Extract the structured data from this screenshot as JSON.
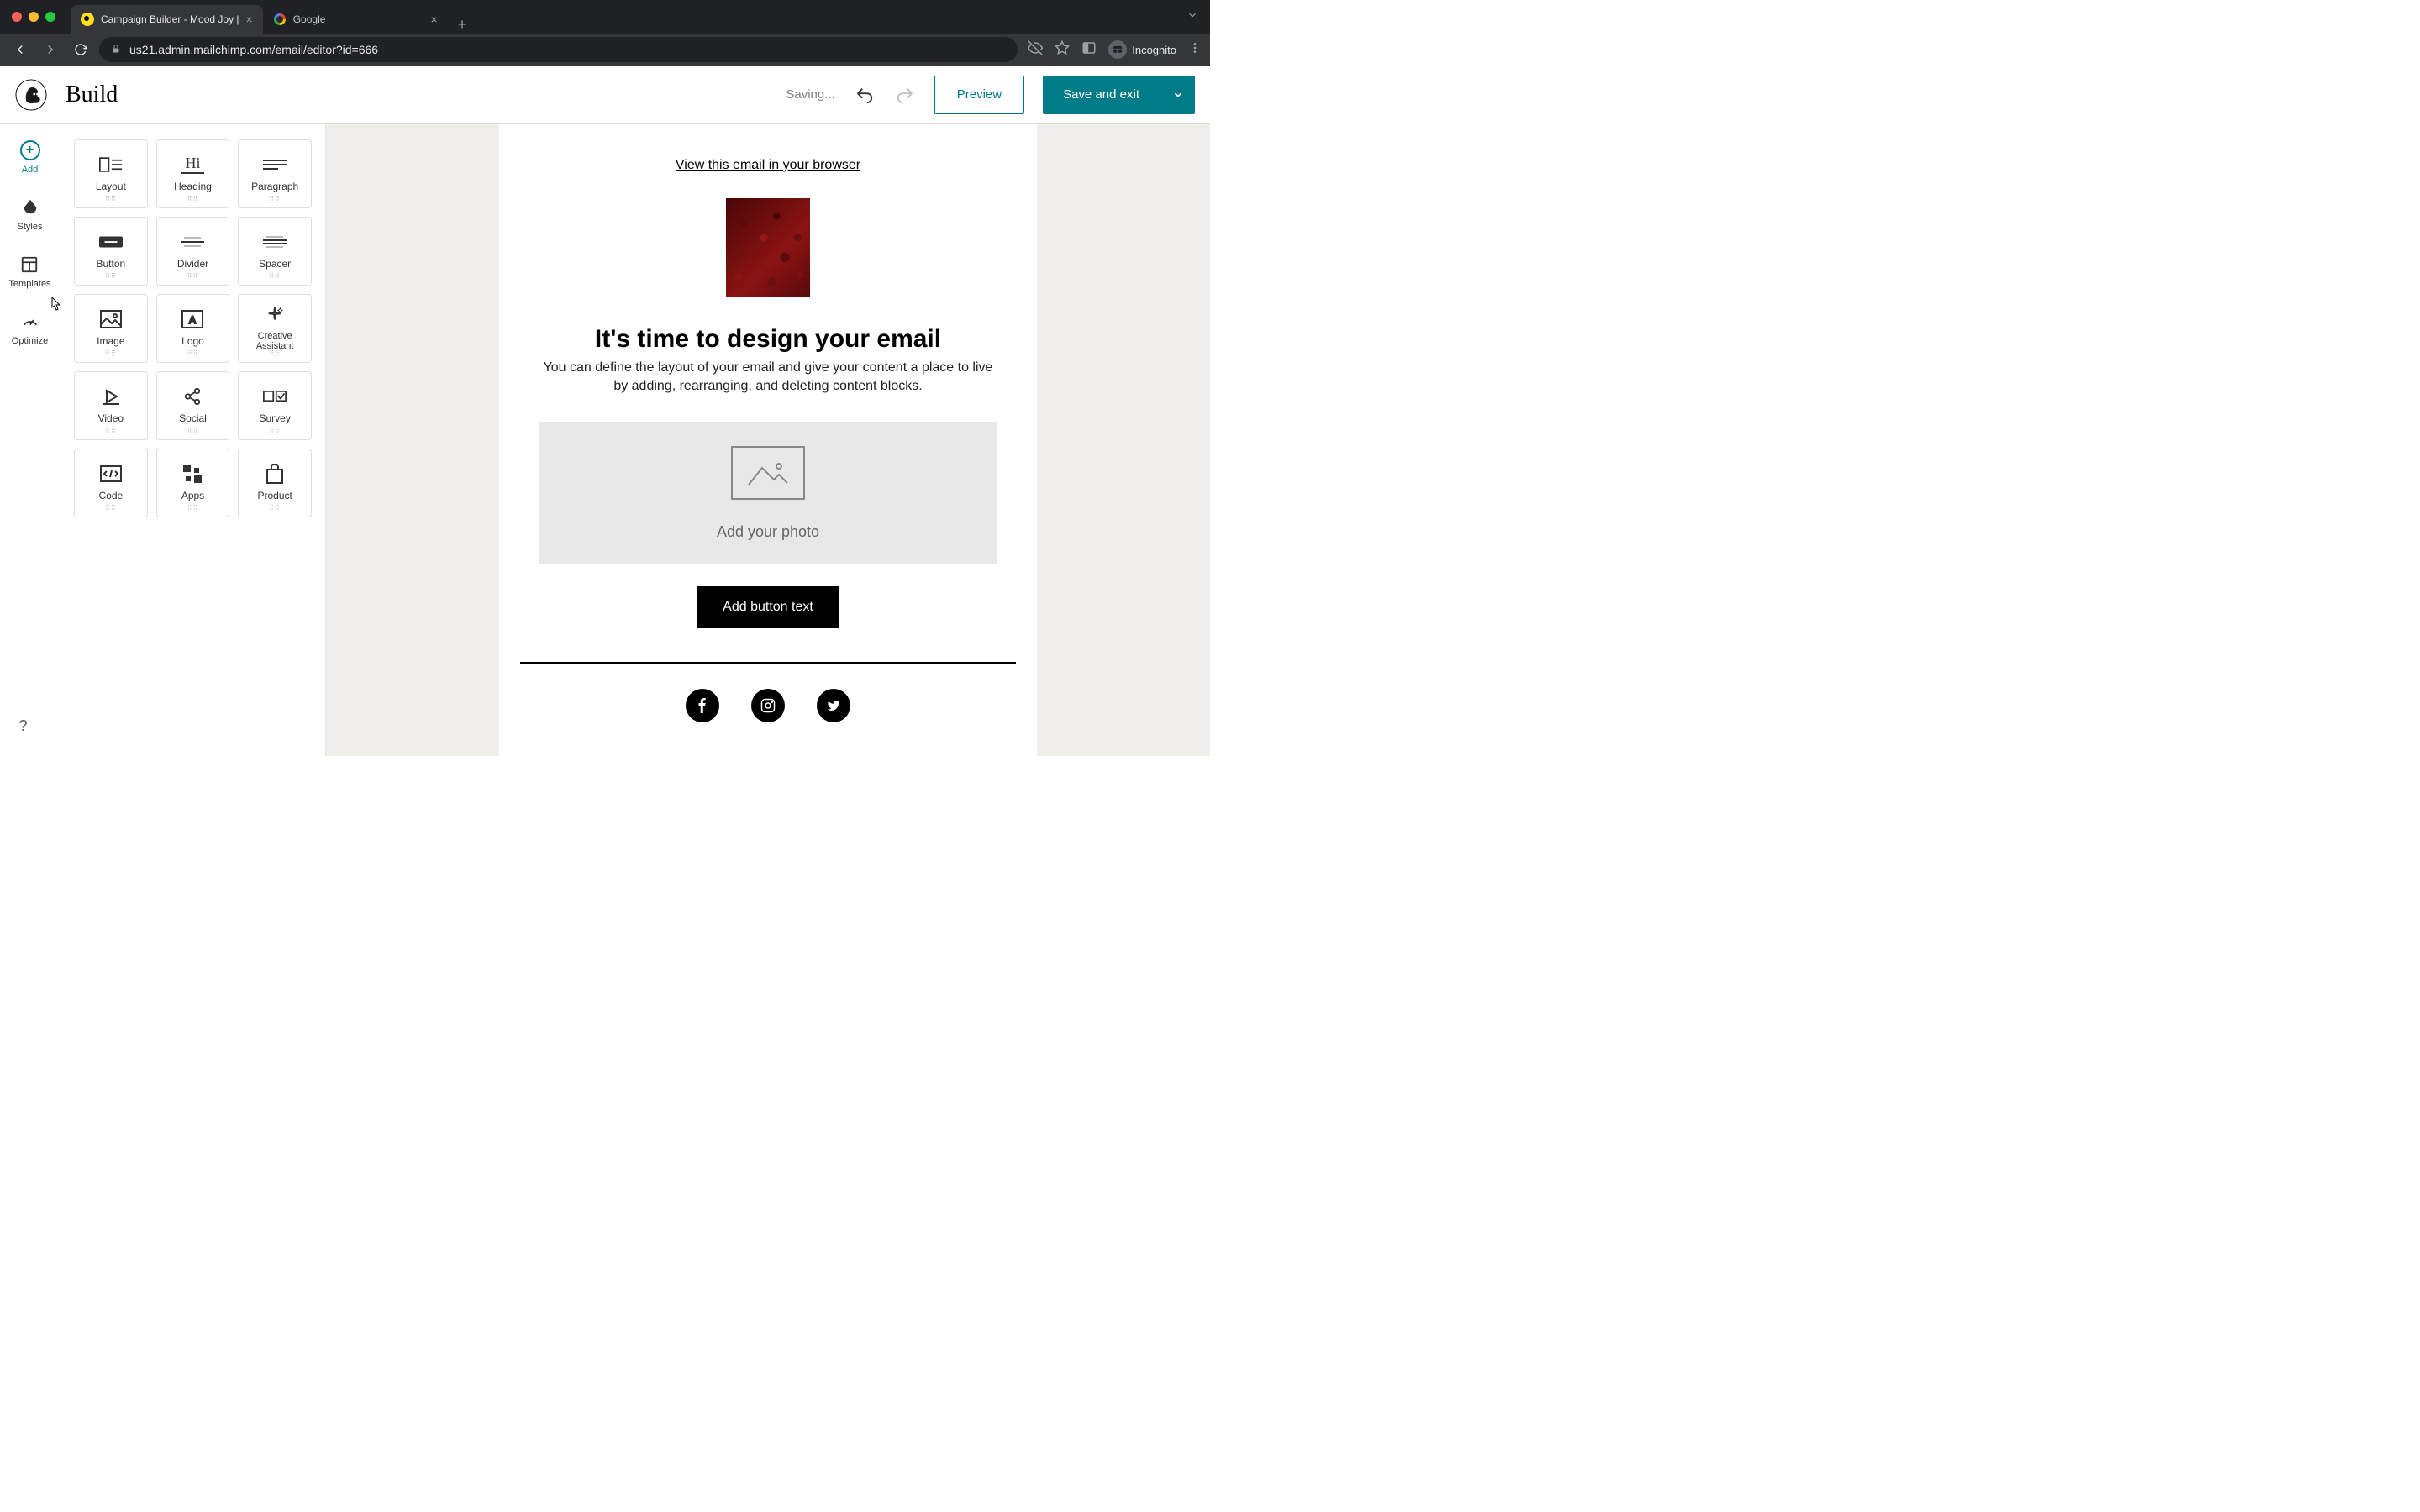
{
  "browser": {
    "tabs": [
      {
        "title": "Campaign Builder - Mood Joy |",
        "active": true,
        "favicon": "mailchimp"
      },
      {
        "title": "Google",
        "active": false,
        "favicon": "google"
      }
    ],
    "url": "us21.admin.mailchimp.com/email/editor?id=666",
    "incognito_label": "Incognito"
  },
  "header": {
    "title": "Build",
    "saving": "Saving...",
    "preview": "Preview",
    "save_exit": "Save and exit"
  },
  "rail": {
    "add": "Add",
    "styles": "Styles",
    "templates": "Templates",
    "optimize": "Optimize",
    "help": "?"
  },
  "blocks": [
    {
      "id": "layout",
      "label": "Layout"
    },
    {
      "id": "heading",
      "label": "Heading"
    },
    {
      "id": "paragraph",
      "label": "Paragraph"
    },
    {
      "id": "button",
      "label": "Button"
    },
    {
      "id": "divider",
      "label": "Divider"
    },
    {
      "id": "spacer",
      "label": "Spacer"
    },
    {
      "id": "image",
      "label": "Image"
    },
    {
      "id": "logo",
      "label": "Logo"
    },
    {
      "id": "creative",
      "label": "Creative Assistant"
    },
    {
      "id": "video",
      "label": "Video"
    },
    {
      "id": "social",
      "label": "Social"
    },
    {
      "id": "survey",
      "label": "Survey"
    },
    {
      "id": "code",
      "label": "Code"
    },
    {
      "id": "apps",
      "label": "Apps"
    },
    {
      "id": "product",
      "label": "Product"
    }
  ],
  "canvas": {
    "view_link": "View this email in your browser",
    "heading": "It's time to design your email",
    "subheading": "You can define the layout of your email and give your content a place to live by adding, rearranging, and deleting content blocks.",
    "photo_placeholder": "Add your photo",
    "button_text": "Add button text"
  }
}
